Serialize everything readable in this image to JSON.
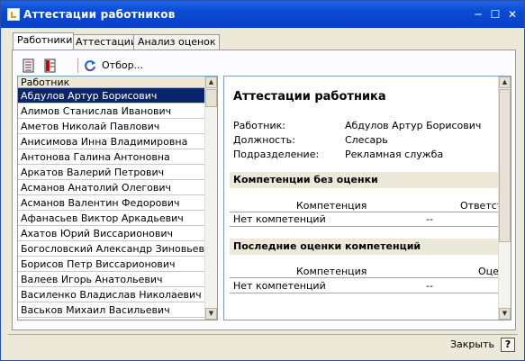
{
  "window": {
    "title": "Аттестации работников"
  },
  "tabs": [
    {
      "label": "Работники",
      "active": true
    },
    {
      "label": "Аттестации",
      "active": false
    },
    {
      "label": "Анализ оценок",
      "active": false
    }
  ],
  "toolbar": {
    "filter_label": "Отбор..."
  },
  "list": {
    "header": "Работник",
    "rows": [
      "Абдулов Артур Борисович",
      "Алимов Станислав Иванович",
      "Аметов Николай Павлович",
      "Анисимова Инна Владимировна",
      "Антонова Галина Антоновна",
      "Аркатов Валерий Петрович",
      "Асманов Анатолий Олегович",
      "Асманов Валентин Федорович",
      "Афанасьев Виктор Аркадьевич",
      "Ахатов Юрий Виссарионович",
      "Богословский Александр Зиновьевич",
      "Борисов Петр Виссарионович",
      "Валеев Игорь Анатольевич",
      "Василенко Владислав Николаевич",
      "Васьков Михаил Васильевич"
    ],
    "selected_index": 0
  },
  "details": {
    "title": "Аттестации работника",
    "fields": [
      {
        "label": "Работник:",
        "value": "Абдулов Артур Борисович"
      },
      {
        "label": "Должность:",
        "value": "Слесарь"
      },
      {
        "label": "Подразделение:",
        "value": "Рекламная служба"
      }
    ],
    "section1": {
      "title": "Компетенции без оценки",
      "col1": "Компетенция",
      "col2": "Ответств",
      "row_value": "Нет компетенций",
      "row_dash": "--"
    },
    "section2": {
      "title": "Последние оценки компетенций",
      "col1": "Компетенция",
      "col2": "Оцен",
      "row_value": "Нет компетенций",
      "row_dash": "--"
    }
  },
  "footer": {
    "close_label": "Закрыть",
    "help_label": "?"
  },
  "colors": {
    "titlebar": "#0a4ad3",
    "selected_row": "#0a246a",
    "window_bg": "#ece9d8"
  }
}
